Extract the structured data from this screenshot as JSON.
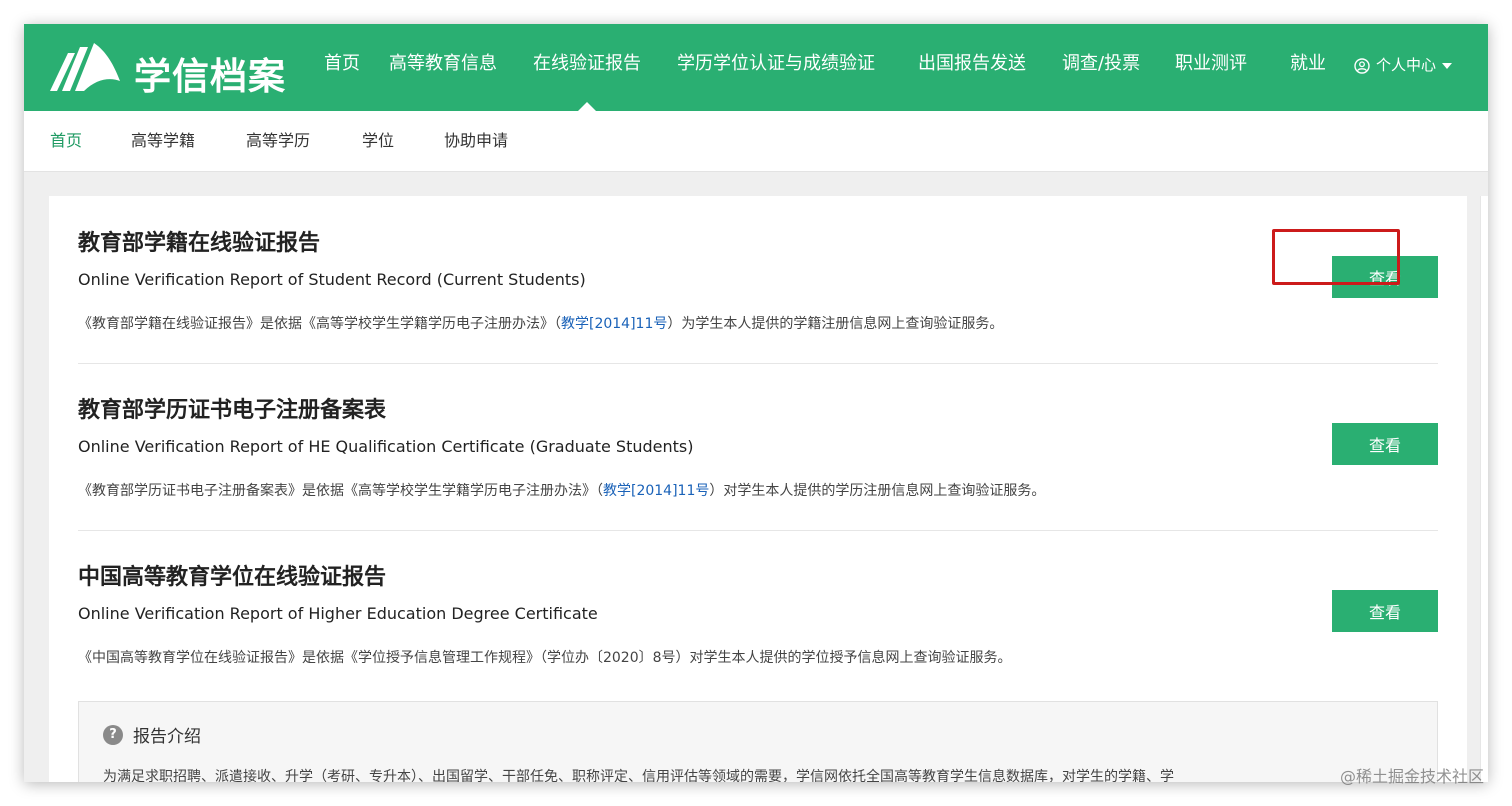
{
  "logo": {
    "text": "学信档案"
  },
  "topnav": {
    "items": [
      "首页",
      "高等教育信息",
      "在线验证报告",
      "学历学位认证与成绩验证",
      "出国报告发送",
      "调查/投票",
      "职业测评",
      "就业"
    ],
    "active": "在线验证报告",
    "user_menu": "个人中心"
  },
  "subnav": {
    "items": [
      "首页",
      "高等学籍",
      "高等学历",
      "学位",
      "协助申请"
    ],
    "active": "首页"
  },
  "reports": [
    {
      "title": "教育部学籍在线验证报告",
      "subtitle": "Online Verification Report of Student Record (Current Students)",
      "desc_prefix": "《教育部学籍在线验证报告》是依据《高等学校学生学籍学历电子注册办法》（",
      "desc_link": "教学[2014]11号",
      "desc_suffix": "）为学生本人提供的学籍注册信息网上查询验证服务。",
      "button": "查看"
    },
    {
      "title": "教育部学历证书电子注册备案表",
      "subtitle": "Online Verification Report of HE Qualification Certificate (Graduate Students)",
      "desc_prefix": "《教育部学历证书电子注册备案表》是依据《高等学校学生学籍学历电子注册办法》（",
      "desc_link": "教学[2014]11号",
      "desc_suffix": "）对学生本人提供的学历注册信息网上查询验证服务。",
      "button": "查看"
    },
    {
      "title": "中国高等教育学位在线验证报告",
      "subtitle": "Online Verification Report of Higher Education Degree Certificate",
      "desc_prefix": "《中国高等教育学位在线验证报告》是依据《学位授予信息管理工作规程》（学位办〔2020〕8号）对学生本人提供的学位授予信息网上查询验证服务。",
      "desc_link": "",
      "desc_suffix": "",
      "button": "查看"
    }
  ],
  "intro": {
    "icon": "question-icon",
    "title": "报告介绍",
    "text": "为满足求职招聘、派遣接收、升学（考研、专升本）、出国留学、干部任免、职称评定、信用评估等领域的需要，学信网依托全国高等教育学生信息数据库，对学生的学籍、学"
  },
  "watermark": "@稀土掘金技术社区",
  "colors": {
    "brand_green": "#2aaf72",
    "link_blue": "#1a62b8",
    "highlight_red": "#cc1b1b"
  }
}
